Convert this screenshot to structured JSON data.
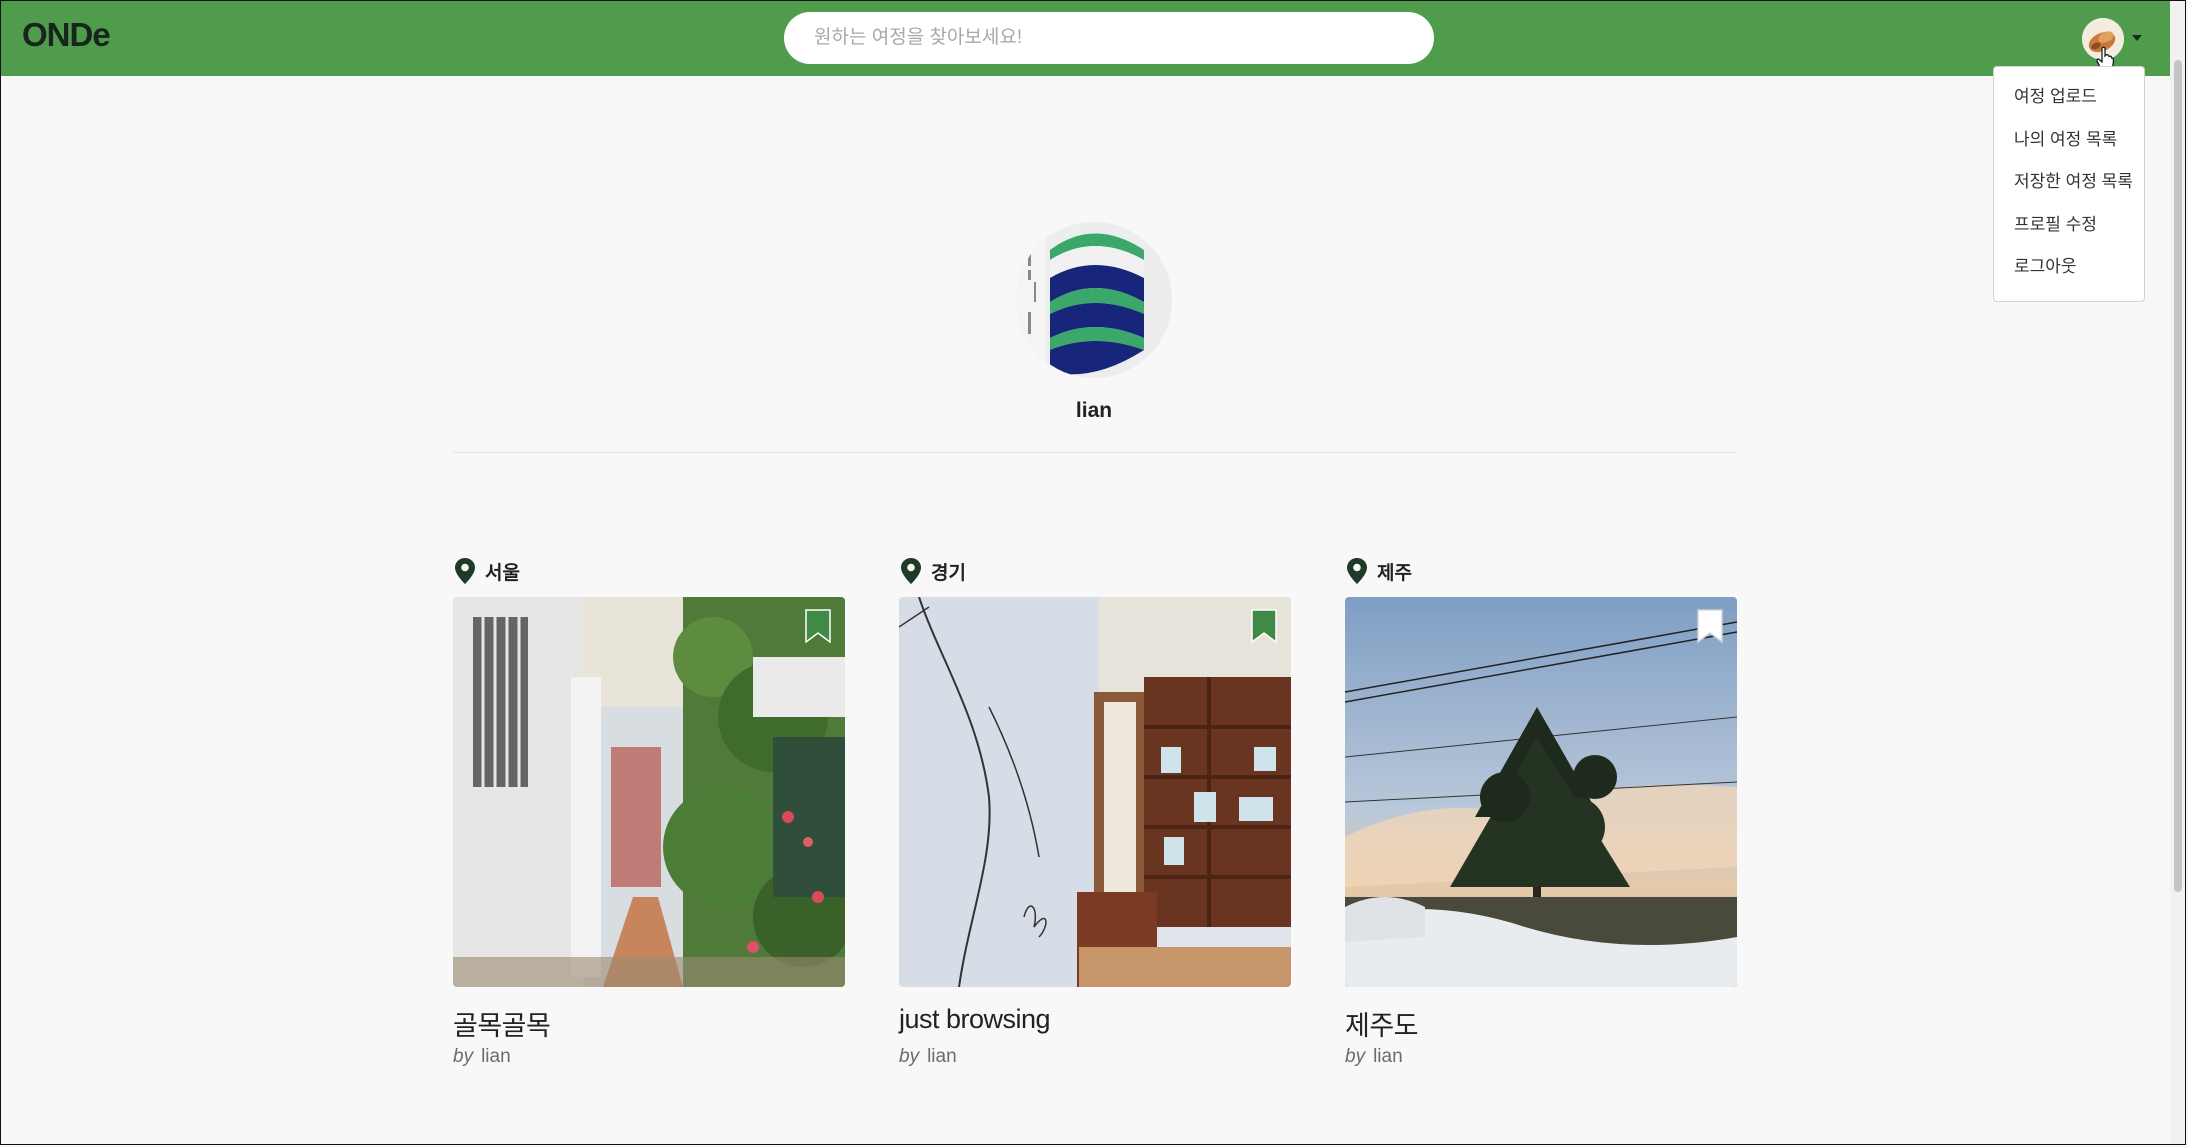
{
  "header": {
    "logo": "ONDe",
    "search_placeholder": "원하는 여정을 찾아보세요!",
    "search_value": ""
  },
  "menu": {
    "items": [
      {
        "label": "여정 업로드"
      },
      {
        "label": "나의 여정 목록"
      },
      {
        "label": "저장한 여정 목록"
      },
      {
        "label": "프로필 수정"
      },
      {
        "label": "로그아웃"
      }
    ]
  },
  "profile": {
    "username": "lian"
  },
  "posts": [
    {
      "location": "서울",
      "title": "골목골목",
      "by_label": "by",
      "author": "lian",
      "bookmarked": true
    },
    {
      "location": "경기",
      "title": "just browsing",
      "by_label": "by",
      "author": "lian",
      "bookmarked": true
    },
    {
      "location": "제주",
      "title": "제주도",
      "by_label": "by",
      "author": "lian",
      "bookmarked": false
    }
  ],
  "icons": {
    "location": "map-pin-icon",
    "bookmark": "bookmark-icon",
    "caret": "caret-down-icon"
  },
  "colors": {
    "header": "#4e9c4c",
    "pin": "#1f3a26",
    "bookmark_filled": "#3f8b45",
    "profile_green": "#3aa86a",
    "profile_navy": "#17257a"
  }
}
